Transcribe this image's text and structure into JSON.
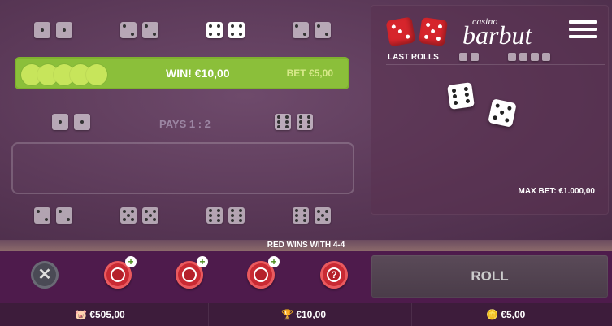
{
  "table": {
    "win_row": {
      "win_label": "WIN! €10,00",
      "bet_label": "BET €5,00",
      "coins": 5
    },
    "pays_label": "PAYS 1 : 2"
  },
  "panel": {
    "logo_small": "casino",
    "logo_big": "barbut",
    "last_rolls_label": "LAST ROLLS",
    "max_bet_label": "MAX BET: €1.000,00"
  },
  "status": {
    "message": "RED WINS WITH 4-4"
  },
  "controls": {
    "roll_label": "ROLL",
    "clear_icon": "x-icon",
    "chip_icons": [
      "chip-plus-icon",
      "chip-plus-icon",
      "chip-plus-icon",
      "help-chip-icon"
    ]
  },
  "footer": {
    "balance": "€505,00",
    "win": "€10,00",
    "bet": "€5,00"
  },
  "colors": {
    "win_row": "#8bbf3a",
    "felt": "#5a3857",
    "control_bar": "#4e1b4c",
    "chip": "#c92a33"
  }
}
